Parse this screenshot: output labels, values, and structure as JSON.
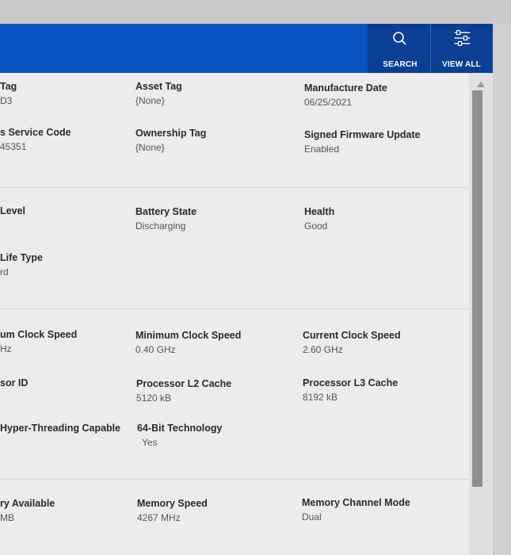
{
  "header": {
    "search_label": "SEARCH",
    "view_all_label": "VIEW ALL",
    "search_icon": "search-icon",
    "view_all_icon": "filter-sliders-icon"
  },
  "sections": {
    "system": [
      {
        "label": "Tag",
        "value": "D3"
      },
      {
        "label": "Asset Tag",
        "value": "{None}"
      },
      {
        "label": "Manufacture Date",
        "value": "06/25/2021"
      },
      {
        "label": "s Service Code",
        "value": "45351"
      },
      {
        "label": "Ownership Tag",
        "value": "{None}"
      },
      {
        "label": "Signed Firmware Update",
        "value": "Enabled"
      }
    ],
    "battery": [
      {
        "label": "Level",
        "value": ""
      },
      {
        "label": "Battery State",
        "value": "Discharging"
      },
      {
        "label": "Health",
        "value": "Good"
      },
      {
        "label": "Life Type",
        "value": "rd"
      }
    ],
    "processor": [
      {
        "label": "um Clock Speed",
        "value": "Hz"
      },
      {
        "label": "Minimum Clock Speed",
        "value": "0.40 GHz"
      },
      {
        "label": "Current Clock Speed",
        "value": "2.60 GHz"
      },
      {
        "label": "sor ID",
        "value": ""
      },
      {
        "label": "Processor L2 Cache",
        "value": "5120 kB"
      },
      {
        "label": "Processor L3 Cache",
        "value": "8192 kB"
      },
      {
        "label": "Hyper-Threading Capable",
        "value": ""
      },
      {
        "label": "64-Bit Technology",
        "value": "Yes"
      }
    ],
    "memory": [
      {
        "label": "ry Available",
        "value": "MB"
      },
      {
        "label": "Memory Speed",
        "value": "4267 MHz"
      },
      {
        "label": "Memory Channel Mode",
        "value": "Dual"
      }
    ]
  }
}
